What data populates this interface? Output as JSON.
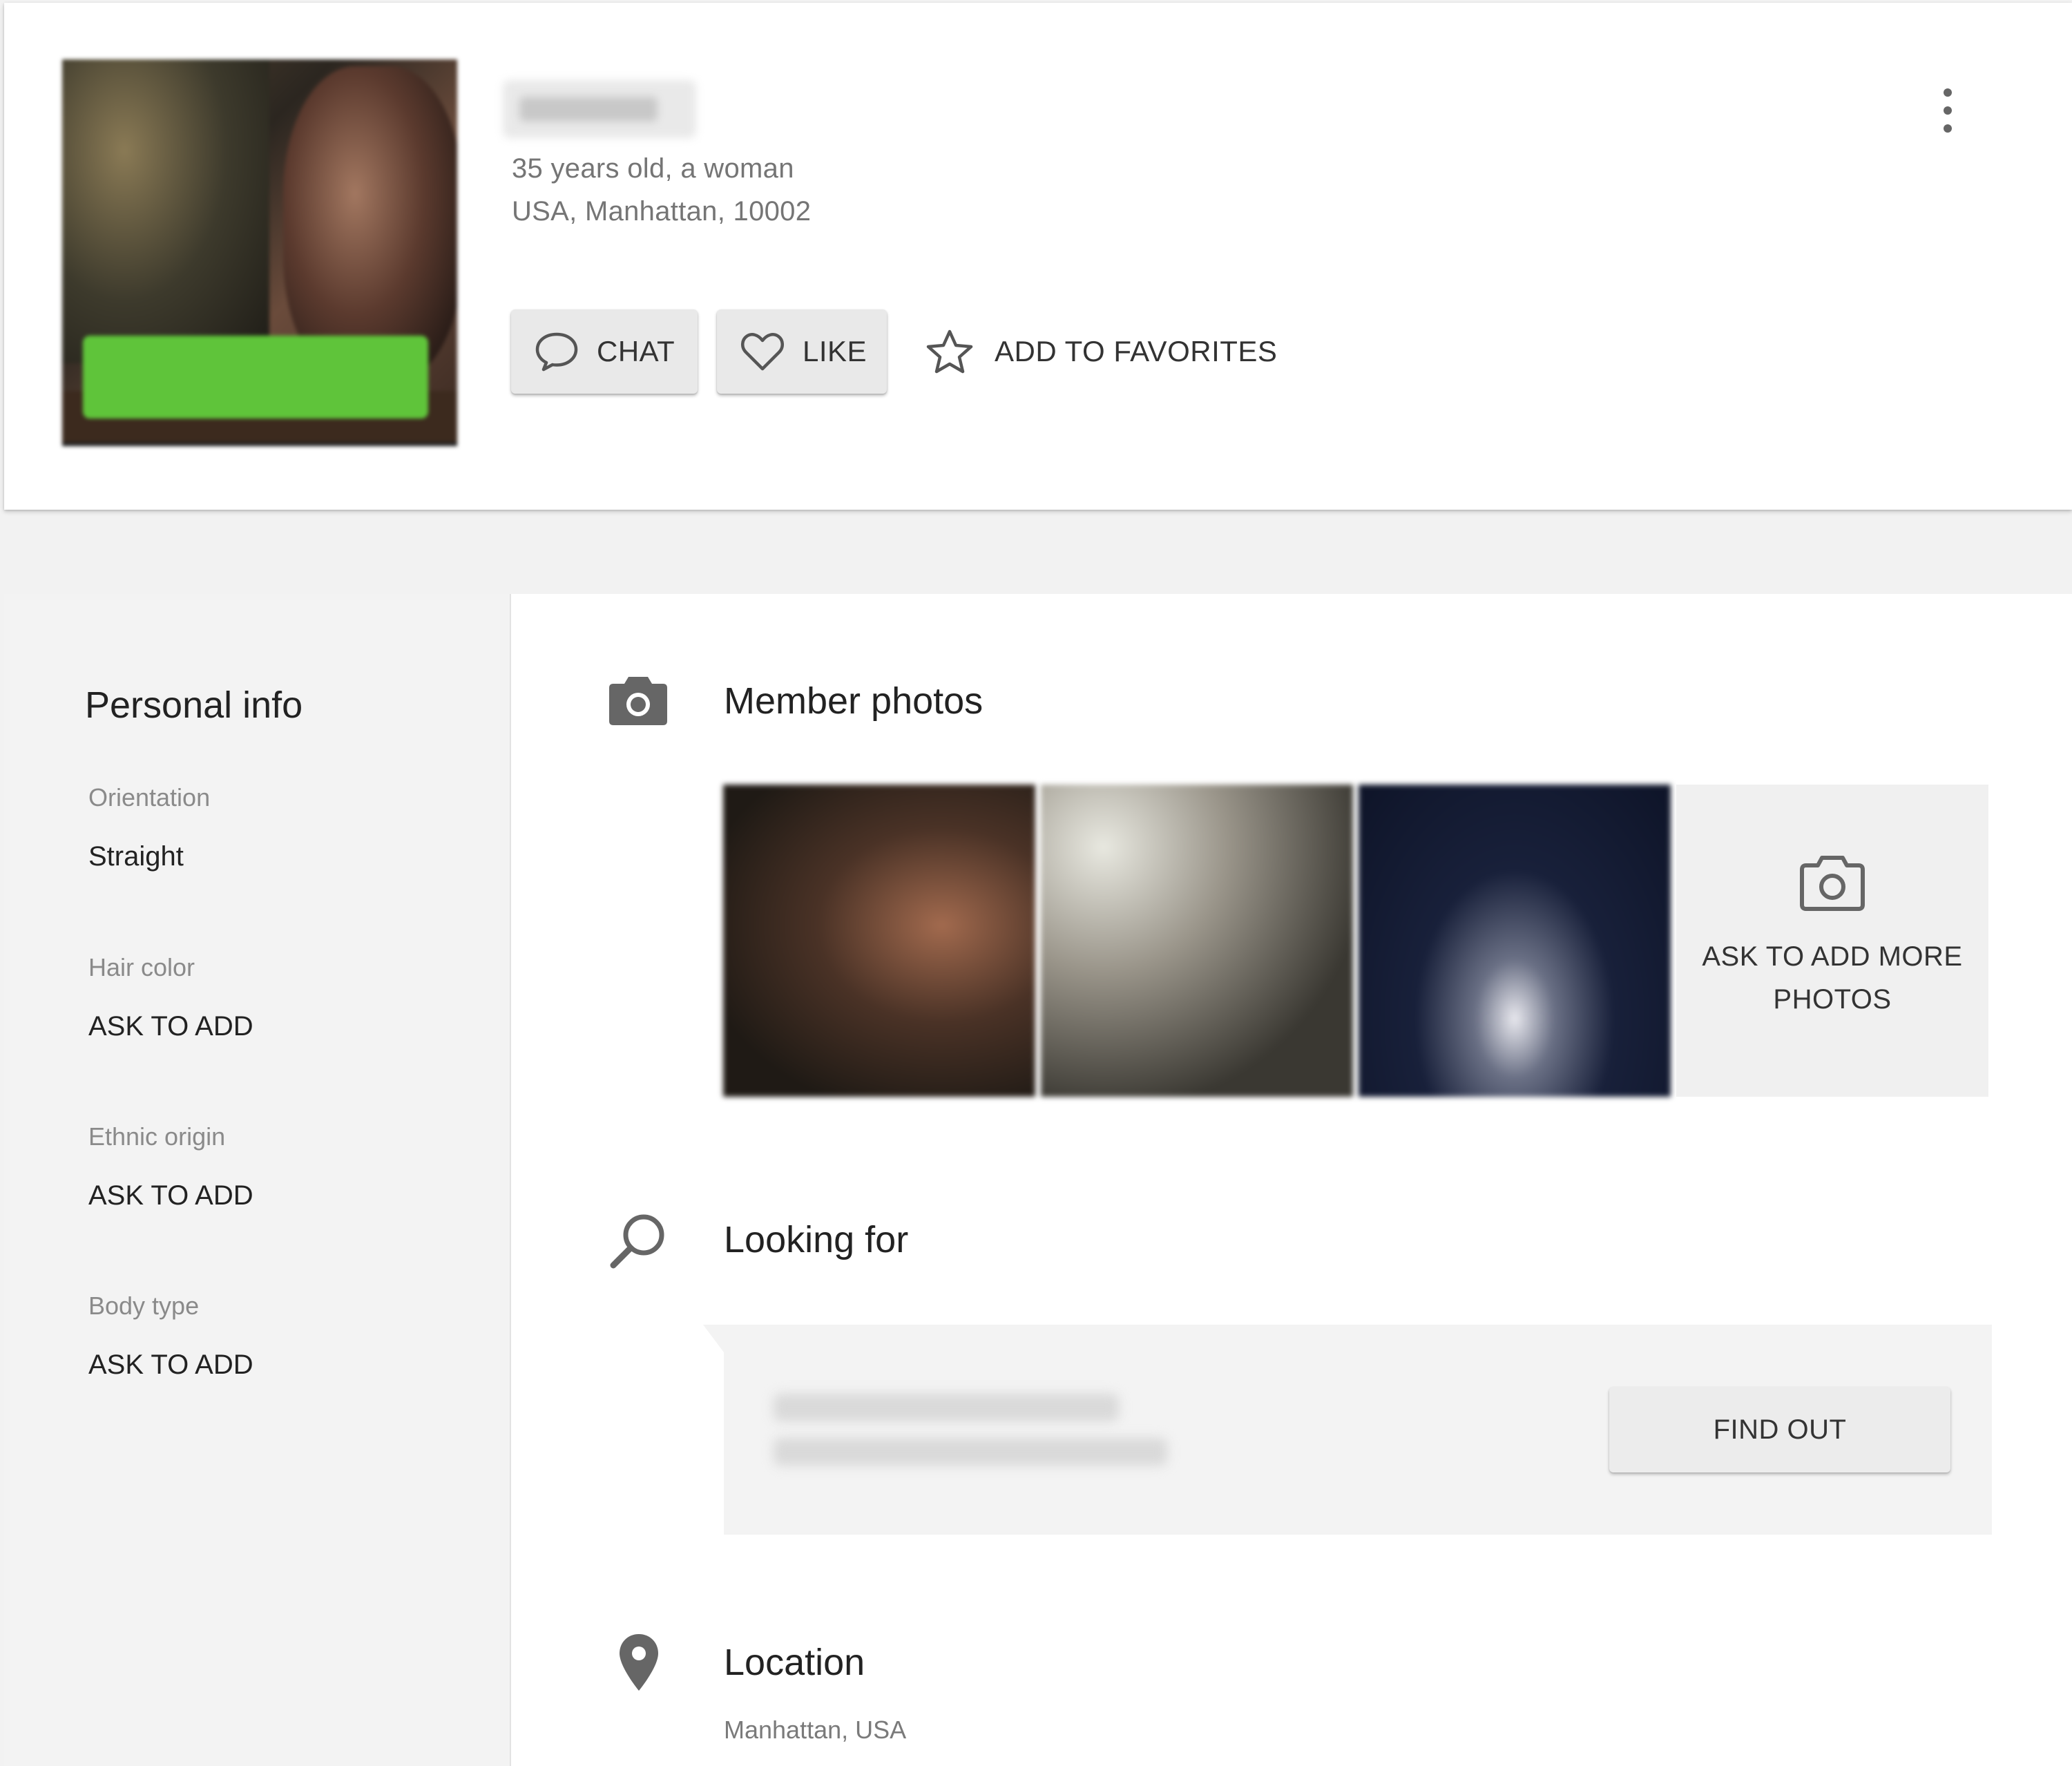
{
  "profile": {
    "age_gender": "35 years old, a woman",
    "location_line": "USA, Manhattan, 10002"
  },
  "actions": {
    "chat_label": "CHAT",
    "like_label": "LIKE",
    "favorites_label": "ADD TO FAVORITES"
  },
  "icons": {
    "more": "more-vertical-icon",
    "chat": "chat-bubble-icon",
    "like": "heart-icon",
    "favorites": "star-icon",
    "photos": "camera-icon",
    "looking_for": "search-icon",
    "location": "location-pin-icon"
  },
  "personal_info": {
    "title": "Personal info",
    "fields": [
      {
        "label": "Orientation",
        "value": "Straight"
      },
      {
        "label": "Hair color",
        "value": "ASK TO ADD"
      },
      {
        "label": "Ethnic origin",
        "value": "ASK TO ADD"
      },
      {
        "label": "Body type",
        "value": "ASK TO ADD"
      }
    ]
  },
  "member_photos": {
    "title": "Member photos",
    "add_more_label": "ASK TO ADD MORE PHOTOS"
  },
  "looking_for": {
    "title": "Looking for",
    "button_label": "FIND OUT"
  },
  "location": {
    "title": "Location",
    "value": "Manhattan, USA"
  },
  "colors": {
    "background": "#f2f2f2",
    "card": "#ffffff",
    "icon_gray": "#666666",
    "button_gray": "#e9e9e9"
  }
}
